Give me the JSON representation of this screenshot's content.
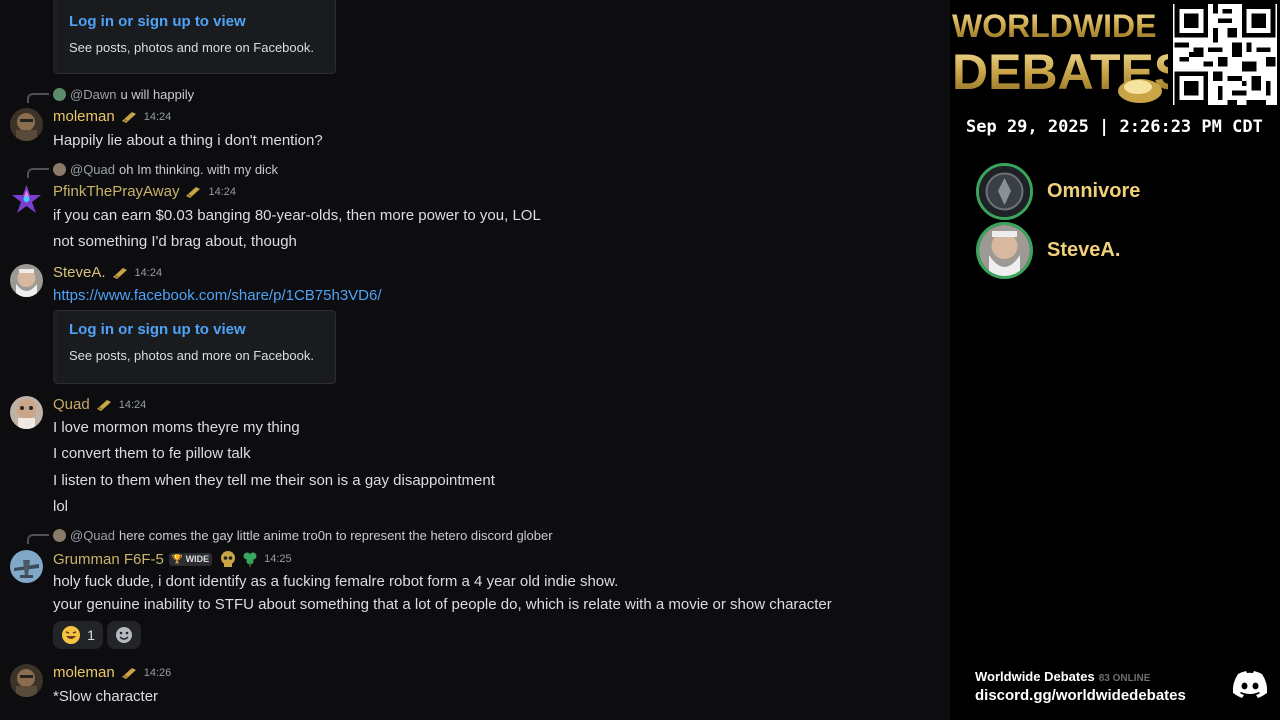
{
  "embed_top": {
    "title": "Log in or sign up to view",
    "desc": "See posts, photos and more on Facebook."
  },
  "messages": {
    "m1": {
      "reply_user": "@Dawn",
      "reply_text": "u will happily",
      "user": "moleman",
      "time": "14:24",
      "lines": [
        "Happily lie about a thing i don't mention?"
      ]
    },
    "m2": {
      "reply_user": "@Quad",
      "reply_text": "oh Im thinking. with my dick",
      "user": "PfinkThePrayAway",
      "time": "14:24",
      "lines": [
        "if you can earn $0.03 banging 80-year-olds, then more power to you, LOL",
        "not something I'd brag about, though"
      ]
    },
    "m3": {
      "user": "SteveA.",
      "time": "14:24",
      "link": "https://www.facebook.com/share/p/1CB75h3VD6/",
      "embed_title": "Log in or sign up to view",
      "embed_desc": "See posts, photos and more on Facebook."
    },
    "m4": {
      "user": "Quad",
      "time": "14:24",
      "lines": [
        "I love mormon moms theyre my thing",
        "I convert them to fe pillow talk",
        "I listen to them when they tell me their son is a gay disappointment",
        "lol"
      ]
    },
    "m5": {
      "reply_user": "@Quad",
      "reply_text": "here comes the gay little anime tro0n to represent the hetero discord glober",
      "user": "Grumman F6F-5",
      "tag": "WIDE",
      "time": "14:25",
      "lines": [
        "holy fuck dude, i dont identify as a fucking femalre robot form a 4 year old indie show.",
        "your genuine inability to STFU about something that a lot of people do, which is relate with a movie or show character"
      ],
      "reaction_count": "1"
    },
    "m6": {
      "user": "moleman",
      "time": "14:26",
      "lines": [
        "*Slow character"
      ]
    }
  },
  "colors": {
    "moleman": "#e8c66a",
    "pfink": "#c9b36b",
    "stevea": "#d9c07c",
    "quad": "#c8a96b",
    "grumman": "#c9b36b"
  },
  "brand": {
    "line1": "WORLDWIDE",
    "line2": "DEBATES"
  },
  "clock": "Sep 29, 2025 | 2:26:23 PM CDT",
  "speakers": [
    {
      "name": "Omnivore"
    },
    {
      "name": "SteveA."
    }
  ],
  "footer": {
    "server": "Worldwide Debates",
    "online": "83 ONLINE",
    "invite": "discord.gg/worldwidedebates"
  }
}
